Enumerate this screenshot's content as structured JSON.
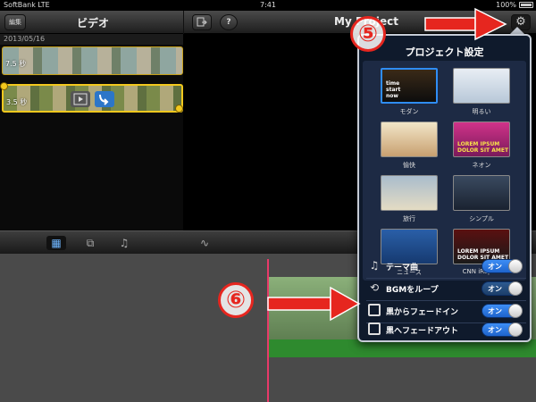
{
  "status": {
    "carrier": "SoftBank  LTE",
    "time": "7:41",
    "battery": "100%"
  },
  "nav": {
    "edit_label": "編集",
    "browser_title": "ビデオ",
    "project_title": "My Project"
  },
  "browser": {
    "date": "2013/05/16",
    "clips": [
      {
        "duration": "7.5 秒"
      },
      {
        "duration": "3.5 秒"
      }
    ]
  },
  "popover": {
    "title": "プロジェクト設定",
    "themes": [
      {
        "name": "モダン",
        "thumb_text": "time\nstart\nnow",
        "selected": true
      },
      {
        "name": "明るい",
        "thumb_text": "",
        "selected": false
      },
      {
        "name": "愉快",
        "thumb_text": "",
        "selected": false
      },
      {
        "name": "ネオン",
        "thumb_text": "LOREM IPSUM DOLOR SIT AMET",
        "selected": false
      },
      {
        "name": "旅行",
        "thumb_text": "",
        "selected": false
      },
      {
        "name": "シンプル",
        "thumb_text": "",
        "selected": false
      },
      {
        "name": "ニュース",
        "thumb_text": "",
        "selected": false
      },
      {
        "name": "CNN iReport",
        "thumb_text": "LOREM IPSUM DOLOR SIT AMET",
        "selected": false
      }
    ],
    "options": [
      {
        "label": "テーマ曲",
        "icon": "music-note-icon",
        "toggle": "オン"
      },
      {
        "label": "BGMをループ",
        "icon": "loop-icon",
        "toggle": "オン"
      },
      {
        "label": "黒からフェードイン",
        "icon": "fade-in-icon",
        "toggle": "オン"
      },
      {
        "label": "黒へフェードアウト",
        "icon": "fade-out-icon",
        "toggle": "オン"
      }
    ]
  },
  "annotations": {
    "step5": "⑤",
    "step6": "⑥"
  },
  "colors": {
    "accent_blue": "#2f8df5",
    "annotation_red": "#e6261f",
    "clip_border": "#f2c81e",
    "playhead": "#e83a6a"
  }
}
